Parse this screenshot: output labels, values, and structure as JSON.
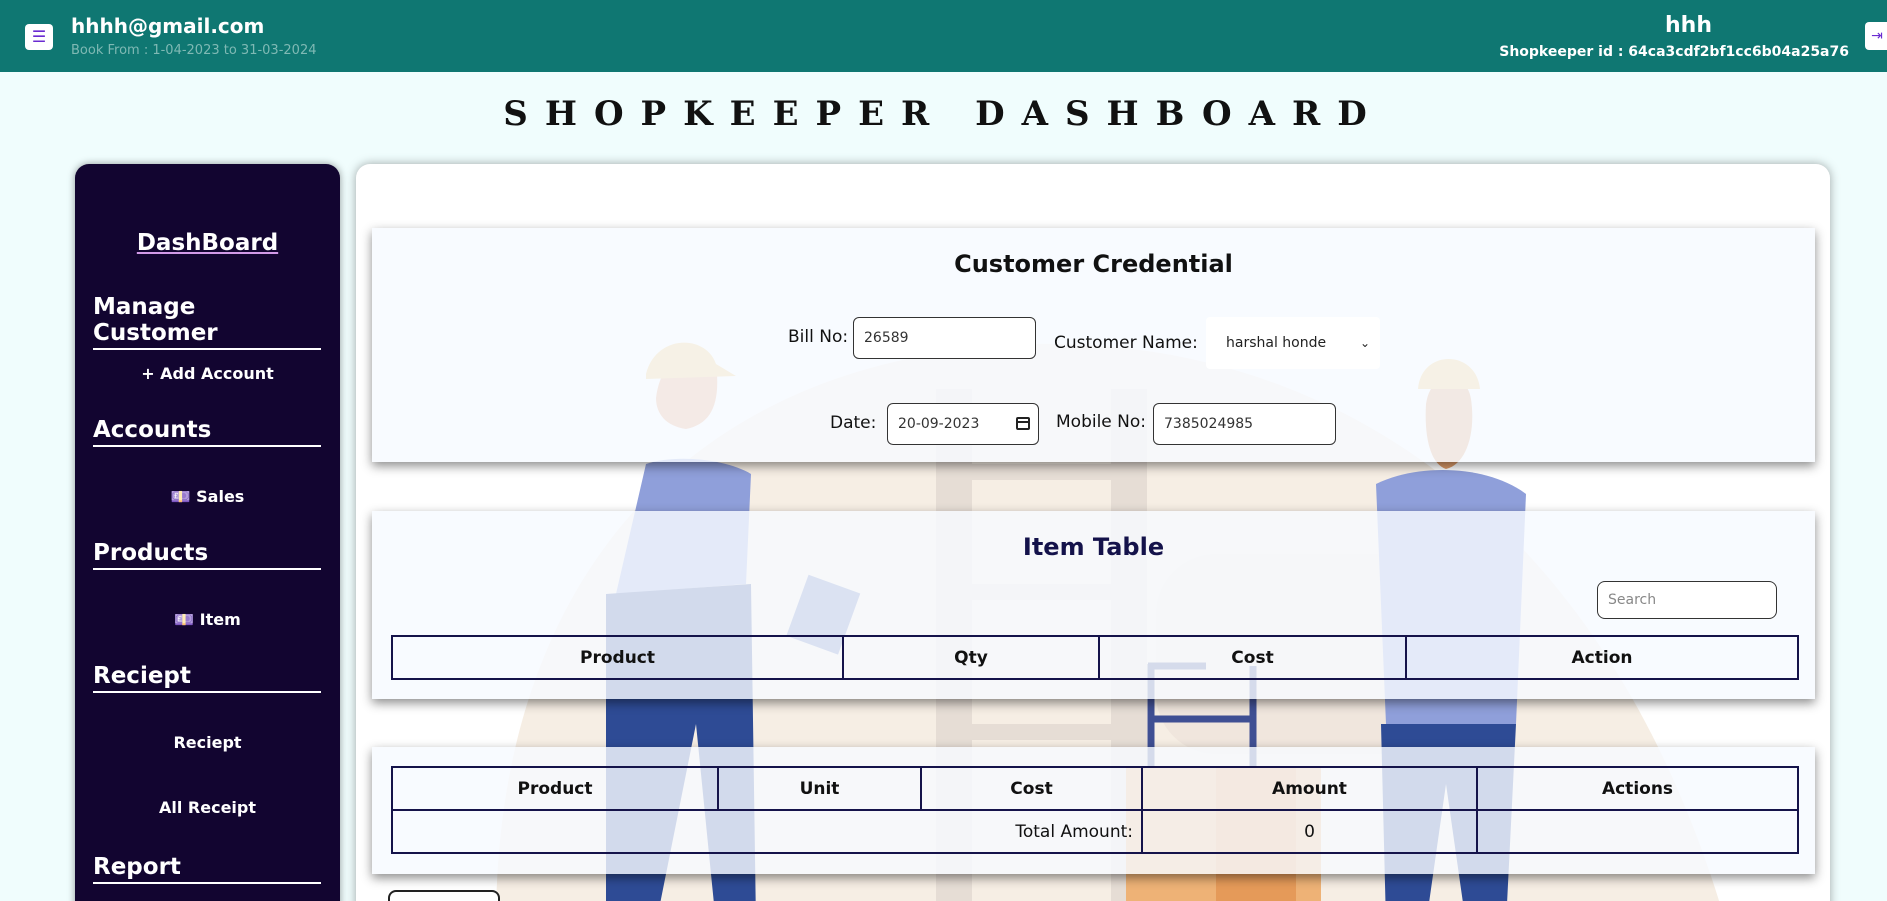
{
  "header": {
    "email": "hhhh@gmail.com",
    "book_range": "Book From : 1-04-2023 to 31-03-2024",
    "shop_name": "hhh",
    "shopkeeper_id": "Shopkeeper id : 64ca3cdf2bf1cc6b04a25a76",
    "menu_icon": "☰",
    "logout_icon": "⇥"
  },
  "page_title": "SHOPKEEPER DASHBOARD",
  "sidebar": {
    "dashboard": "DashBoard",
    "manage_customer": "Manage Customer",
    "add_account": "+ Add Account",
    "accounts": "Accounts",
    "sales": "💷 Sales",
    "products": "Products",
    "item": "💷 Item",
    "reciept_head": "Reciept",
    "reciept": "Reciept",
    "all_receipt": "All Receipt",
    "report": "Report"
  },
  "customer_credential": {
    "title": "Customer Credential",
    "bill_no_label": "Bill No:",
    "bill_no_value": "26589",
    "customer_name_label": "Customer Name:",
    "customer_name_value": "harshal honde",
    "date_label": "Date:",
    "date_value": "20-09-2023",
    "mobile_label": "Mobile No:",
    "mobile_value": "7385024985"
  },
  "item_table": {
    "title": "Item Table",
    "search_placeholder": "Search",
    "columns": [
      "Product",
      "Qty",
      "Cost",
      "Action"
    ]
  },
  "bill_table": {
    "columns": [
      "Product",
      "Unit",
      "Cost",
      "Amount",
      "Actions"
    ],
    "total_label": "Total Amount:",
    "total_value": "0"
  },
  "colors": {
    "header_bg": "#0f7772",
    "sidebar_bg": "#120530",
    "table_border": "#15134a"
  }
}
